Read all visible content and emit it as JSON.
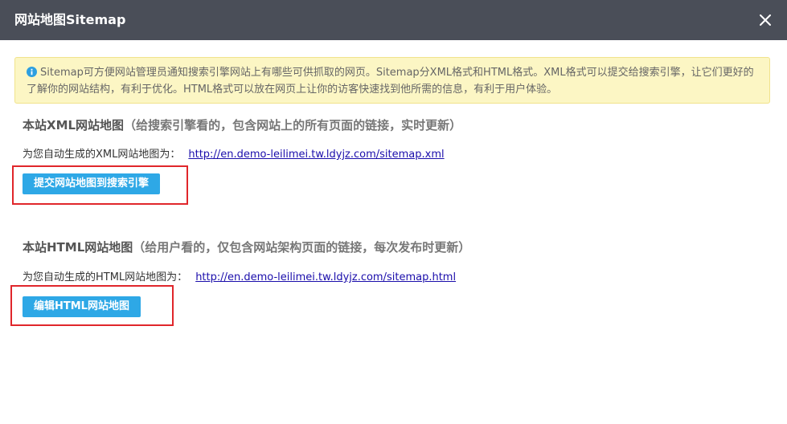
{
  "dialog": {
    "title": "网站地图Sitemap",
    "close_icon": "close-icon"
  },
  "notice": {
    "icon": "info-icon",
    "text": "Sitemap可方便网站管理员通知搜索引擎网站上有哪些可供抓取的网页。Sitemap分XML格式和HTML格式。XML格式可以提交给搜索引擎，让它们更好的了解你的网站结构，有利于优化。HTML格式可以放在网页上让你的访客快速找到他所需的信息，有利于用户体验。"
  },
  "xml_section": {
    "heading": "本站XML网站地图",
    "subheading": "（给搜索引擎看的，包含网站上的所有页面的链接，实时更新）",
    "label": "为您自动生成的XML网站地图为：",
    "url": "http://en.demo-leilimei.tw.ldyjz.com/sitemap.xml",
    "button_label": "提交网站地图到搜索引擎"
  },
  "html_section": {
    "heading": "本站HTML网站地图",
    "subheading": "（给用户看的，仅包含网站架构页面的链接，每次发布时更新）",
    "label": "为您自动生成的HTML网站地图为：",
    "url": "http://en.demo-leilimei.tw.ldyjz.com/sitemap.html",
    "button_label": "编辑HTML网站地图"
  },
  "colors": {
    "titlebar": "#4a4e58",
    "notice_bg": "#fcf6c4",
    "button": "#2ea8e6",
    "highlight": "#e0262b",
    "link": "#1a0dab",
    "info_icon": "#2d9fe0"
  }
}
